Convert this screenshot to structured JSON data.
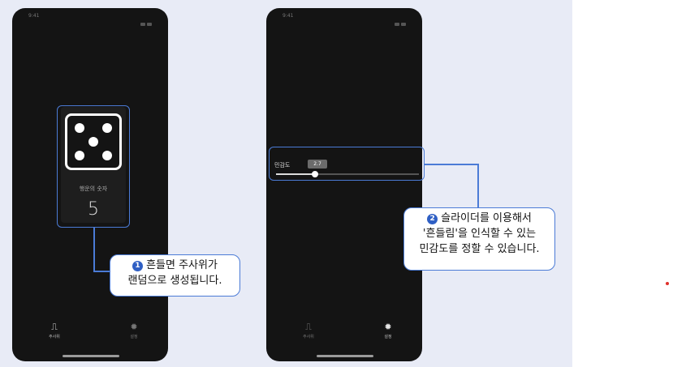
{
  "screen1": {
    "status_time": "9:41",
    "luck_label": "행운의 숫자",
    "lucky_number": "5",
    "tabs": [
      {
        "label": "주사위",
        "icon": "dice-shake-icon"
      },
      {
        "label": "설정",
        "icon": "gear-icon"
      }
    ]
  },
  "screen2": {
    "status_time": "9:41",
    "sensitivity_label": "민감도",
    "slider_value": "2.7",
    "slider_fraction": 0.27,
    "tabs": [
      {
        "label": "주사위",
        "icon": "dice-shake-icon"
      },
      {
        "label": "설정",
        "icon": "gear-icon"
      }
    ]
  },
  "callouts": [
    {
      "number": "1",
      "line1": "흔들면 주사위가",
      "line2": "랜덤으로 생성됩니다."
    },
    {
      "number": "2",
      "line1": "슬라이더를 이용해서",
      "line2": "'흔들림'을 인식할 수 있는",
      "line3": "민감도를 정할 수 있습니다."
    }
  ],
  "colors": {
    "accent": "#4b7bd6",
    "background": "#e8ebf6",
    "screen": "#141414"
  }
}
